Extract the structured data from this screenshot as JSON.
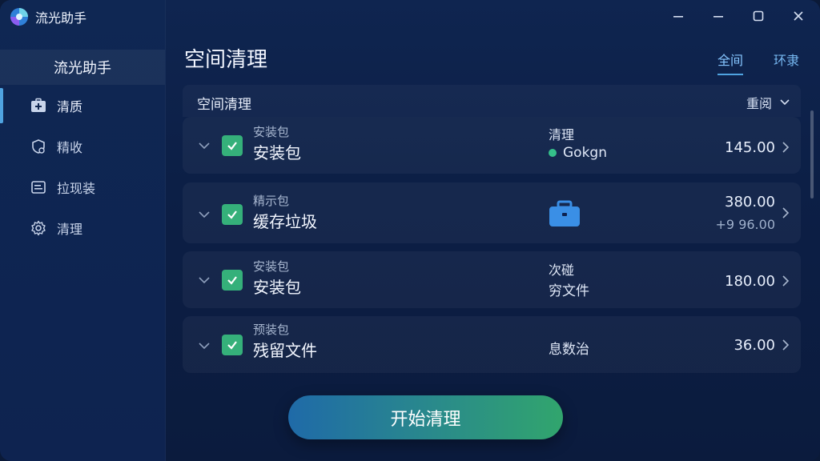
{
  "app": {
    "title": "流光助手"
  },
  "sidebar": {
    "header": "流光助手",
    "items": [
      {
        "label": "清质",
        "icon": "medkit-icon",
        "active": true
      },
      {
        "label": "精收",
        "icon": "shield-icon",
        "active": false
      },
      {
        "label": "拉现装",
        "icon": "list-icon",
        "active": false
      },
      {
        "label": "清理",
        "icon": "gear-icon",
        "active": false
      }
    ]
  },
  "window_controls": [
    "minimize",
    "maximize",
    "restore",
    "close"
  ],
  "main": {
    "title": "空间清理",
    "tabs": [
      {
        "label": "全间",
        "active": true
      },
      {
        "label": "环隶",
        "active": false
      }
    ],
    "panel": {
      "title": "空间清理",
      "sort_label": "重阅"
    },
    "rows": [
      {
        "small": "安装包",
        "name": "安装包",
        "col_a": "清理",
        "col_b": "Gokgn",
        "value": "145.00",
        "checked": true
      },
      {
        "small": "精示包",
        "name": "缓存垃圾",
        "col_icon": "briefcase-icon",
        "value": "380.00",
        "value2": "+9 96.00",
        "checked": true
      },
      {
        "small": "安装包",
        "name": "安装包",
        "col_a": "次碰",
        "col_b": "穷文件",
        "value": "180.00",
        "checked": true
      },
      {
        "small": "预装包",
        "name": "残留文件",
        "col_b": "息数治",
        "value": "36.00",
        "checked": true
      }
    ],
    "start_button": "开始清理"
  },
  "colors": {
    "accent": "#4fa3e0",
    "check": "#35b07a",
    "briefcase": "#3a8fe6",
    "status_dot": "#35c08a"
  }
}
